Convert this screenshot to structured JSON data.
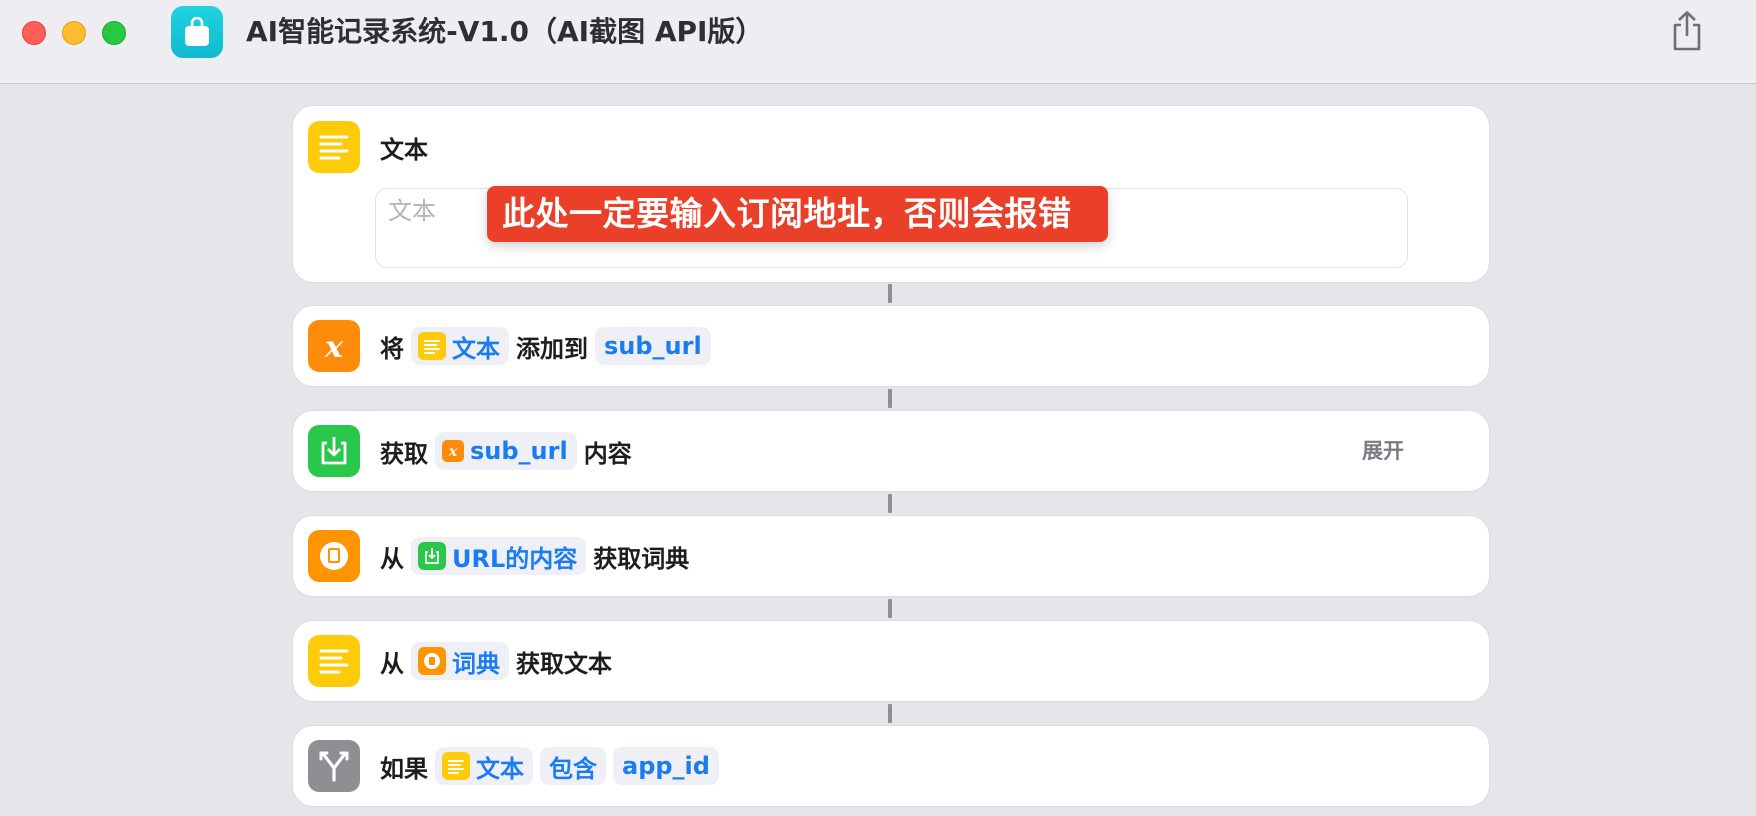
{
  "window": {
    "title": "AI智能记录系统-V1.0（AI截图 API版）"
  },
  "colors": {
    "text_yellow": "#fecb0a",
    "variable_orange": "#fe8c0a",
    "download_green": "#2ac84a",
    "dictionary_orange": "#fe9400",
    "if_gray": "#8e8e93",
    "token_blue": "#1b7cf2",
    "callout_red": "#ea3f28"
  },
  "actions": [
    {
      "icon": "text-lines-icon",
      "title": "文本",
      "placeholder": "文本"
    },
    {
      "icon": "variable-x-icon",
      "word1": "将",
      "token1": "文本",
      "word2": "添加到",
      "token2": "sub_url"
    },
    {
      "icon": "download-tray-icon",
      "word1": "获取",
      "token1": "sub_url",
      "word2": "内容",
      "expand": "展开"
    },
    {
      "icon": "dictionary-book-icon",
      "word1": "从",
      "token1": "URL的内容",
      "word2": "获取词典"
    },
    {
      "icon": "text-lines-icon",
      "word1": "从",
      "token1": "词典",
      "word2": "获取文本"
    },
    {
      "icon": "branch-if-icon",
      "word1": "如果",
      "token1": "文本",
      "token2": "包含",
      "token3": "app_id"
    }
  ],
  "annotation": {
    "text": "此处一定要输入订阅地址，否则会报错"
  },
  "toolbar": {
    "share_icon": "share-icon"
  }
}
